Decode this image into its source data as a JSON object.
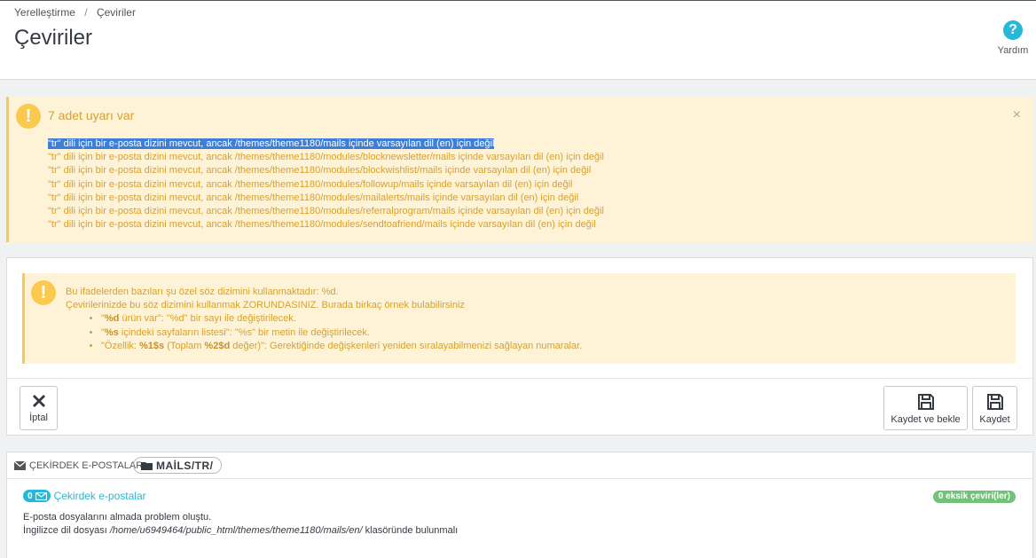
{
  "breadcrumb": {
    "parent": "Yerelleştirme",
    "separator": "/",
    "current": "Çeviriler"
  },
  "page_title": "Çeviriler",
  "help": {
    "icon": "?",
    "label": "Yardım"
  },
  "warnings": {
    "icon": "!",
    "title": "7 adet uyarı var",
    "close": "×",
    "items": [
      "\"tr\" dili için bir e-posta dizini mevcut, ancak /themes/theme1180/mails içinde varsayılan dil (en) için değil",
      "\"tr\" dili için bir e-posta dizini mevcut, ancak /themes/theme1180/modules/blocknewsletter/mails içinde varsayılan dil (en) için değil",
      "\"tr\" dili için bir e-posta dizini mevcut, ancak /themes/theme1180/modules/blockwishlist/mails içinde varsayılan dil (en) için değil",
      "\"tr\" dili için bir e-posta dizini mevcut, ancak /themes/theme1180/modules/followup/mails içinde varsayılan dil (en) için değil",
      "\"tr\" dili için bir e-posta dizini mevcut, ancak /themes/theme1180/modules/mailalerts/mails içinde varsayılan dil (en) için değil",
      "\"tr\" dili için bir e-posta dizini mevcut, ancak /themes/theme1180/modules/referralprogram/mails içinde varsayılan dil (en) için değil",
      "\"tr\" dili için bir e-posta dizini mevcut, ancak /themes/theme1180/modules/sendtoafriend/mails içinde varsayılan dil (en) için değil"
    ]
  },
  "info": {
    "icon": "!",
    "line1": "Bu ifadelerden bazıları şu özel söz dizimini kullanmaktadır: %d.",
    "line2": "Çevirilerinizde bu söz dizimini kullanmak ZORUNDASINIZ. Burada birkaç örnek bulabilirsiniz",
    "b1_q1": "\"",
    "b1_bold": "%d",
    "b1_rest": " ürün var\": \"%d\" bir sayı ile değiştirilecek.",
    "b2_q1": "\"",
    "b2_bold": "%s",
    "b2_rest": " içindeki sayfaların listesi\": \"%s\" bir metin ile değiştirilecek.",
    "b3_pre": "\"Özellik: ",
    "b3_bold1": "%1$s",
    "b3_mid": " (Toplam ",
    "b3_bold2": "%2$d",
    "b3_rest": " değer)\": Gerektiğinde değişkenleri yeniden sıralayabilmenizi sağlayan numaralar."
  },
  "toolbar": {
    "cancel": "İptal",
    "save_stay": "Kaydet ve bekle",
    "save": "Kaydet"
  },
  "mails": {
    "header_label": "ÇEKİRDEK E-POSTALAR",
    "folder": "MAİLS/TR/",
    "count": "0",
    "core_title": "Çekirdek e-postalar",
    "missing": "0 eksik çeviri(ler)",
    "error": "E-posta dosyalarını almada problem oluştu.",
    "path_pre": "İngilizce dil dosyası ",
    "path": "/home/u6949464/public_html/themes/theme1180/mails/en/",
    "path_post": " klasöründe bulunmalı"
  },
  "colors": {
    "accent": "#25b9d7",
    "warning": "#fcc94f",
    "warning_bg": "#fff3d7",
    "success": "#72c279"
  }
}
